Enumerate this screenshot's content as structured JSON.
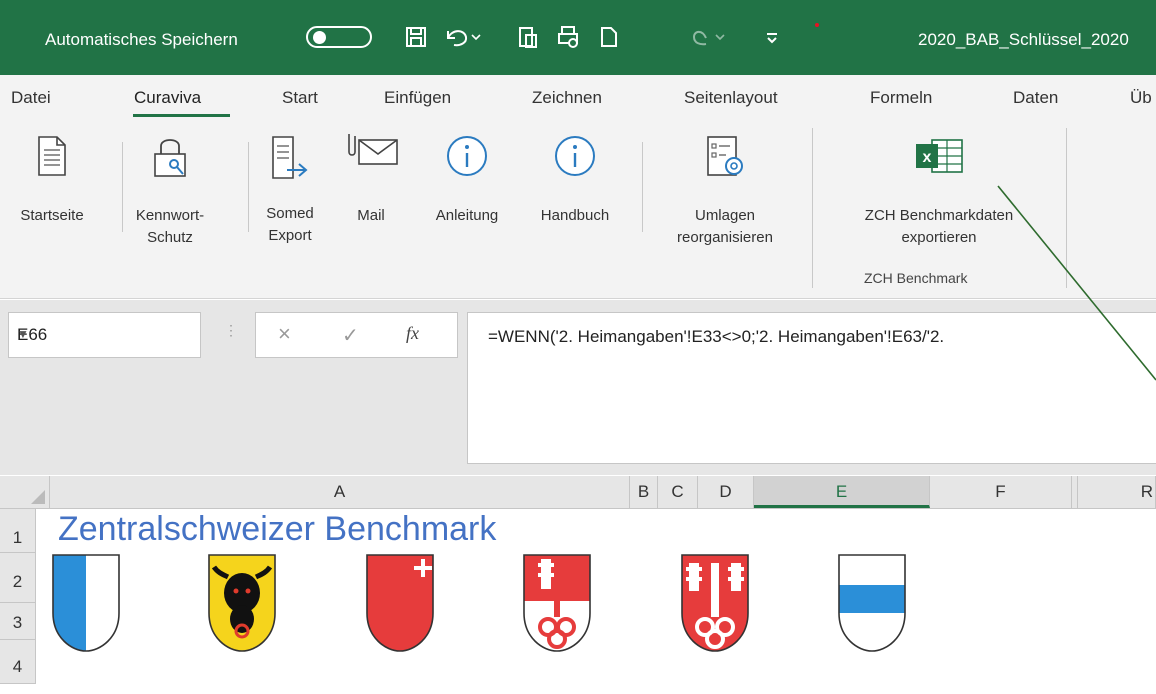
{
  "titlebar": {
    "autosave_label": "Automatisches Speichern",
    "document_title": "2020_BAB_Schlüssel_2020"
  },
  "tabs": [
    "Datei",
    "Curaviva",
    "Start",
    "Einfügen",
    "Zeichnen",
    "Seitenlayout",
    "Formeln",
    "Daten",
    "Üb"
  ],
  "active_tab": "Curaviva",
  "ribbon": {
    "startseite": "Startseite",
    "kennwort_1": "Kennwort-",
    "kennwort_2": "Schutz",
    "somed_1": "Somed",
    "somed_2": "Export",
    "mail": "Mail",
    "anleitung": "Anleitung",
    "handbuch": "Handbuch",
    "umlagen_1": "Umlagen",
    "umlagen_2": "reorganisieren",
    "zch_1": "ZCH Benchmarkdaten",
    "zch_2": "exportieren",
    "group_zch": "ZCH Benchmark"
  },
  "formula_bar": {
    "name_box": "E66",
    "formula": "=WENN('2. Heimangaben'!E33<>0;'2. Heimangaben'!E63/'2.",
    "cancel_icon": "×",
    "enter_icon": "✓",
    "fx_icon": "fx"
  },
  "columns": [
    "A",
    "B",
    "C",
    "D",
    "E",
    "F",
    "R"
  ],
  "rows": [
    "1",
    "2",
    "3",
    "4"
  ],
  "sheet_title": "Zentralschweizer Benchmark",
  "colors": {
    "excel_green": "#217346",
    "title_blue": "#4472c4"
  },
  "crests": [
    "luzern-crest",
    "uri-crest",
    "schwyz-crest",
    "obwalden-crest",
    "nidwalden-crest",
    "zug-crest"
  ]
}
